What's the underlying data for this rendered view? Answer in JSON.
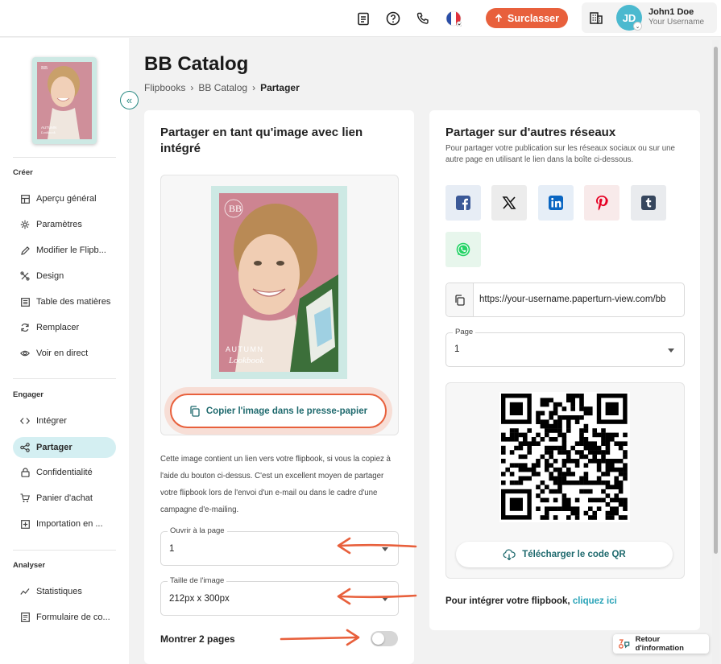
{
  "topbar": {
    "icons": [
      "document-icon",
      "help-icon",
      "phone-icon",
      "french-flag-icon"
    ],
    "upgrade_label": "Surclasser",
    "user_initials": "JD",
    "user_name": "John1 Doe",
    "user_sub": "Your Username"
  },
  "sidebar": {
    "cover": {
      "brand": "BB",
      "line1": "AUTUMN",
      "line2": "Lookbook"
    },
    "sections": [
      {
        "title": "Créer",
        "items": [
          {
            "label": "Aperçu général",
            "icon": "grid-icon"
          },
          {
            "label": "Paramètres",
            "icon": "gear-icon"
          },
          {
            "label": "Modifier le Flipb...",
            "icon": "pencil-icon"
          },
          {
            "label": "Design",
            "icon": "palette-icon"
          },
          {
            "label": "Table des matières",
            "icon": "list-icon"
          },
          {
            "label": "Remplacer",
            "icon": "refresh-icon"
          },
          {
            "label": "Voir en direct",
            "icon": "eye-icon"
          }
        ]
      },
      {
        "title": "Engager",
        "items": [
          {
            "label": "Intégrer",
            "icon": "code-icon"
          },
          {
            "label": "Partager",
            "icon": "share-icon",
            "active": true
          },
          {
            "label": "Confidentialité",
            "icon": "lock-icon"
          },
          {
            "label": "Panier d'achat",
            "icon": "cart-icon"
          },
          {
            "label": "Importation en ...",
            "icon": "import-icon"
          }
        ]
      },
      {
        "title": "Analyser",
        "items": [
          {
            "label": "Statistiques",
            "icon": "chart-icon"
          },
          {
            "label": "Formulaire de co...",
            "icon": "form-icon"
          }
        ]
      }
    ]
  },
  "main": {
    "title": "BB Catalog",
    "breadcrumb": [
      "Flipbooks",
      "BB Catalog",
      "Partager"
    ]
  },
  "left_card": {
    "title_line1": "Partager en tant qu'image avec lien",
    "title_line2": "intégré",
    "cover": {
      "brand": "BB",
      "line1": "AUTUMN",
      "line2": "Lookbook"
    },
    "copy_button": "Copier l'image dans le presse-papier",
    "description": "Cette image contient un lien vers votre flipbook, si vous la copiez à l'aide du bouton ci-dessus. C'est un excellent moyen de partager votre flipbook lors de l'envoi d'un e-mail ou dans le cadre d'une campagne d'e-mailing.",
    "open_page_label": "Ouvrir à la page",
    "open_page_value": "1",
    "image_size_label": "Taille de l'image",
    "image_size_value": "212px x 300px",
    "show_two_pages_label": "Montrer 2 pages",
    "show_two_pages_on": false
  },
  "right_card": {
    "title": "Partager sur d'autres réseaux",
    "description": "Pour partager votre publication sur les réseaux sociaux ou sur une autre page en utilisant le lien dans la boîte ci-dessous.",
    "social": [
      {
        "name": "facebook-icon",
        "color": "#3b5998",
        "bg": "#e7edf5"
      },
      {
        "name": "x-icon",
        "color": "#111111",
        "bg": "#ececec"
      },
      {
        "name": "linkedin-icon",
        "color": "#0a66c2",
        "bg": "#e6eef7"
      },
      {
        "name": "pinterest-icon",
        "color": "#e60023",
        "bg": "#f8eaea"
      },
      {
        "name": "tumblr-icon",
        "color": "#36465d",
        "bg": "#e9ebee"
      },
      {
        "name": "whatsapp-icon",
        "color": "#25d366",
        "bg": "#e7f6ec"
      }
    ],
    "url": "https://your-username.paperturn-view.com/bb",
    "page_label": "Page",
    "page_value": "1",
    "qr_button": "Télécharger le code QR",
    "embed_text": "Pour intégrer votre flipbook, ",
    "embed_link": "cliquez ici"
  },
  "help_button": "Retour d'information",
  "colors": {
    "accent": "#e8603c",
    "teal": "#1f6a6e",
    "active_bg": "#d4eff2"
  }
}
